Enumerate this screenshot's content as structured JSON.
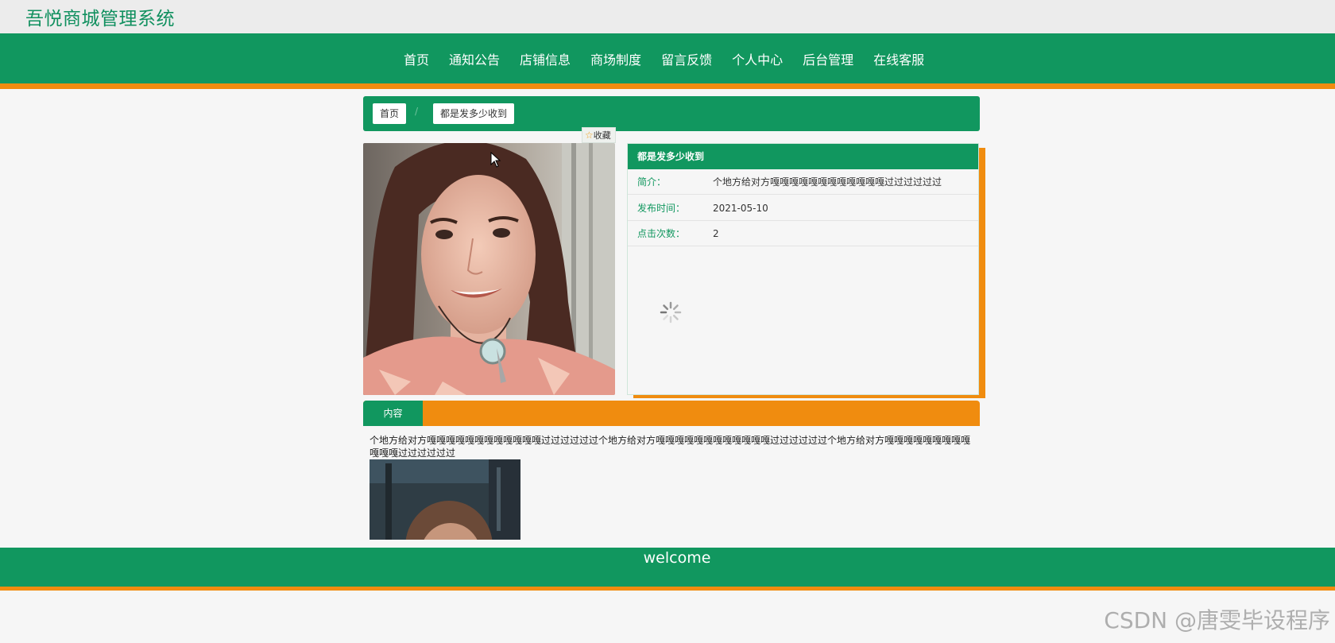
{
  "site": {
    "title": "吾悦商城管理系统"
  },
  "nav": {
    "items": [
      "首页",
      "通知公告",
      "店铺信息",
      "商场制度",
      "留言反馈",
      "个人中心",
      "后台管理",
      "在线客服"
    ]
  },
  "breadcrumb": {
    "home": "首页",
    "separator": "/",
    "current": "都是发多少收到"
  },
  "favorite": {
    "label": "收藏",
    "icon": "star-icon"
  },
  "detail": {
    "title": "都是发多少收到",
    "rows": [
      {
        "label": "简介：",
        "value": "个地方给对方嘎嘎嘎嘎嘎嘎嘎嘎嘎嘎嘎嘎过过过过过过"
      },
      {
        "label": "发布时间：",
        "value": "2021-05-10"
      },
      {
        "label": "点击次数：",
        "value": "2"
      }
    ],
    "loading_icon": "spinner-icon"
  },
  "content": {
    "tab_label": "内容",
    "text": "个地方给对方嘎嘎嘎嘎嘎嘎嘎嘎嘎嘎嘎嘎过过过过过过个地方给对方嘎嘎嘎嘎嘎嘎嘎嘎嘎嘎嘎嘎过过过过过过个地方给对方嘎嘎嘎嘎嘎嘎嘎嘎嘎嘎嘎嘎过过过过过过"
  },
  "footer": {
    "text": "welcome"
  },
  "watermark": {
    "text": "CSDN @唐雯毕设程序"
  },
  "colors": {
    "brand_green": "#11975f",
    "accent_orange": "#f08c0f",
    "title_green": "#11905f"
  }
}
